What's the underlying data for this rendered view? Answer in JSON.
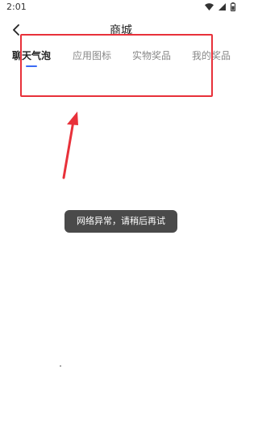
{
  "status_bar": {
    "time": "2:01",
    "icons": [
      "wifi-icon",
      "signal-icon",
      "battery-icon"
    ]
  },
  "header": {
    "title": "商城",
    "back_icon": "chevron-left-icon"
  },
  "tabs": [
    {
      "label": "聊天气泡",
      "active": true
    },
    {
      "label": "应用图标",
      "active": false
    },
    {
      "label": "实物奖品",
      "active": false
    },
    {
      "label": "我的奖品",
      "active": false
    }
  ],
  "toast": {
    "message": "网络异常，请稍后再试"
  },
  "colors": {
    "accent": "#3b6bf5",
    "annotation": "#e8313a",
    "toast_bg": "#4a4a4a"
  }
}
